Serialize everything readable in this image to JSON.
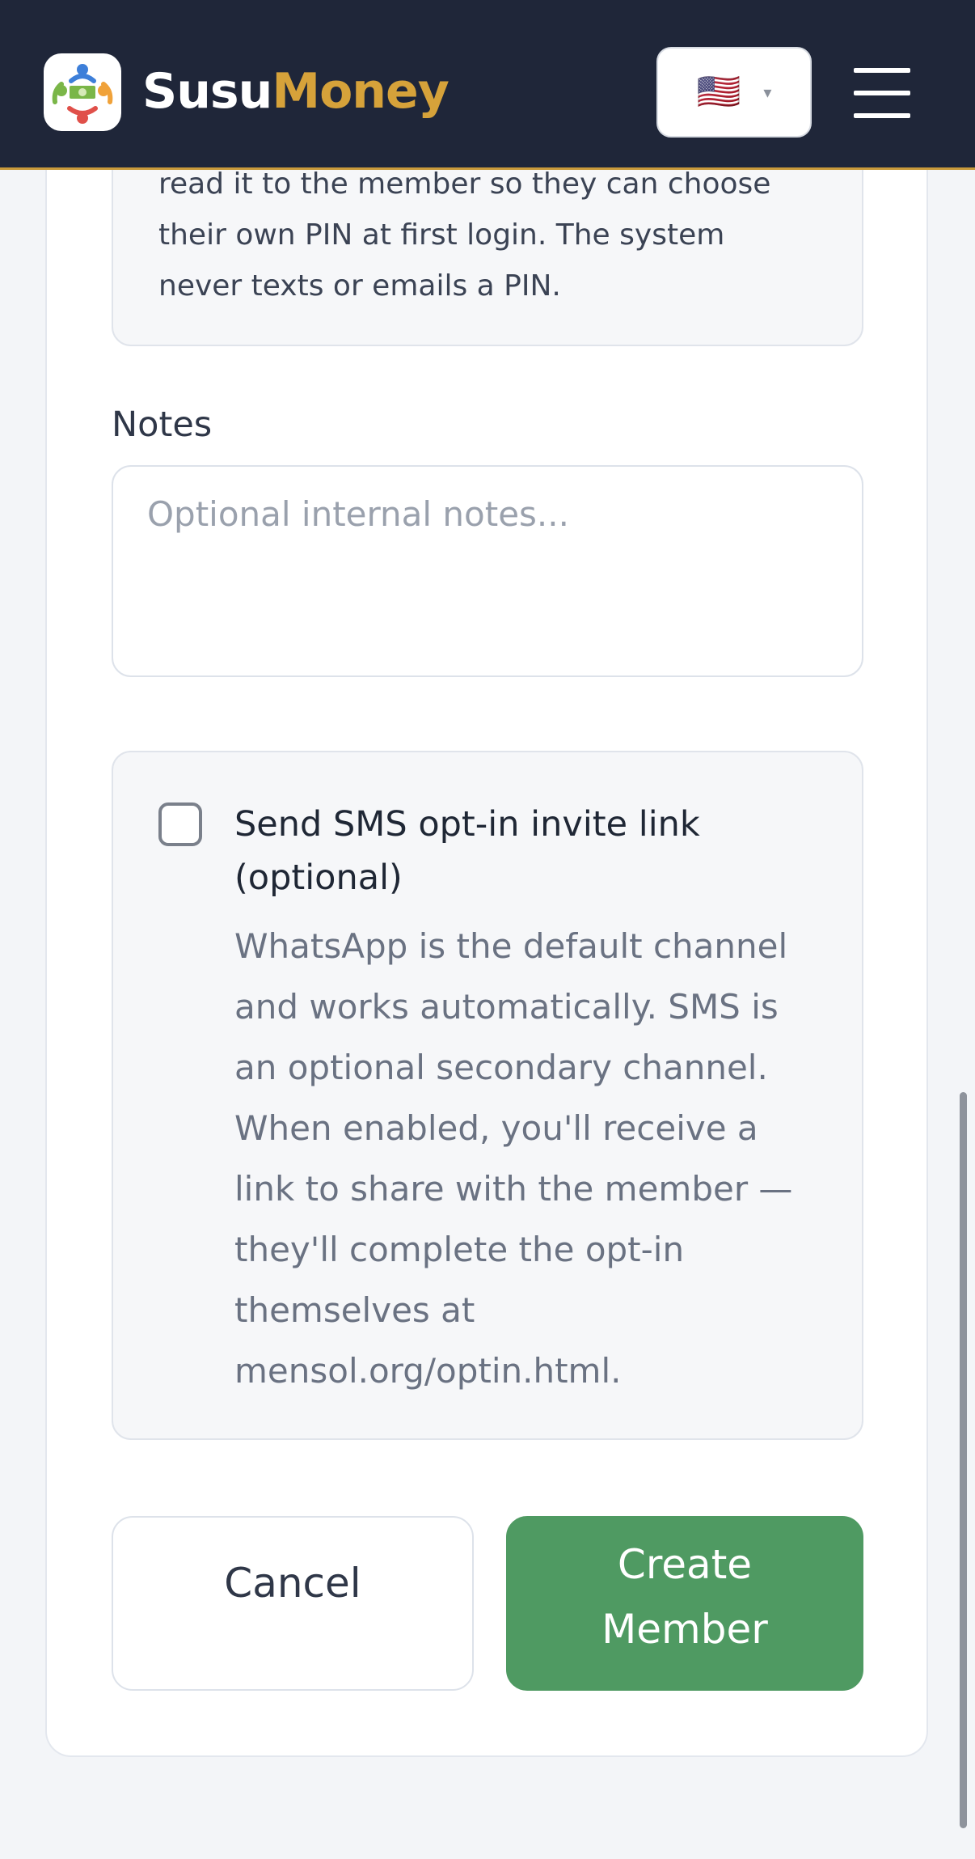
{
  "header": {
    "brand_part1": "Susu",
    "brand_part2": "Money",
    "language_flag": "🇺🇸",
    "language_caret": "▾",
    "menu_icon": "hamburger-icon",
    "colors": {
      "background": "#1f2639",
      "brand_gold": "#d6a23a"
    }
  },
  "info_box": {
    "text": "read it to the member so they can choose their own PIN at first login. The system never texts or emails a PIN."
  },
  "notes": {
    "label": "Notes",
    "placeholder": "Optional internal notes...",
    "value": ""
  },
  "sms_optin": {
    "checked": false,
    "title": "Send SMS opt-in invite link (optional)",
    "description": "WhatsApp is the default channel and works automatically. SMS is an optional secondary channel. When enabled, you'll receive a link to share with the member — they'll complete the opt-in themselves at mensol.org/optin.html."
  },
  "actions": {
    "cancel_label": "Cancel",
    "create_label": "Create Member",
    "create_color": "#4f9a62"
  }
}
